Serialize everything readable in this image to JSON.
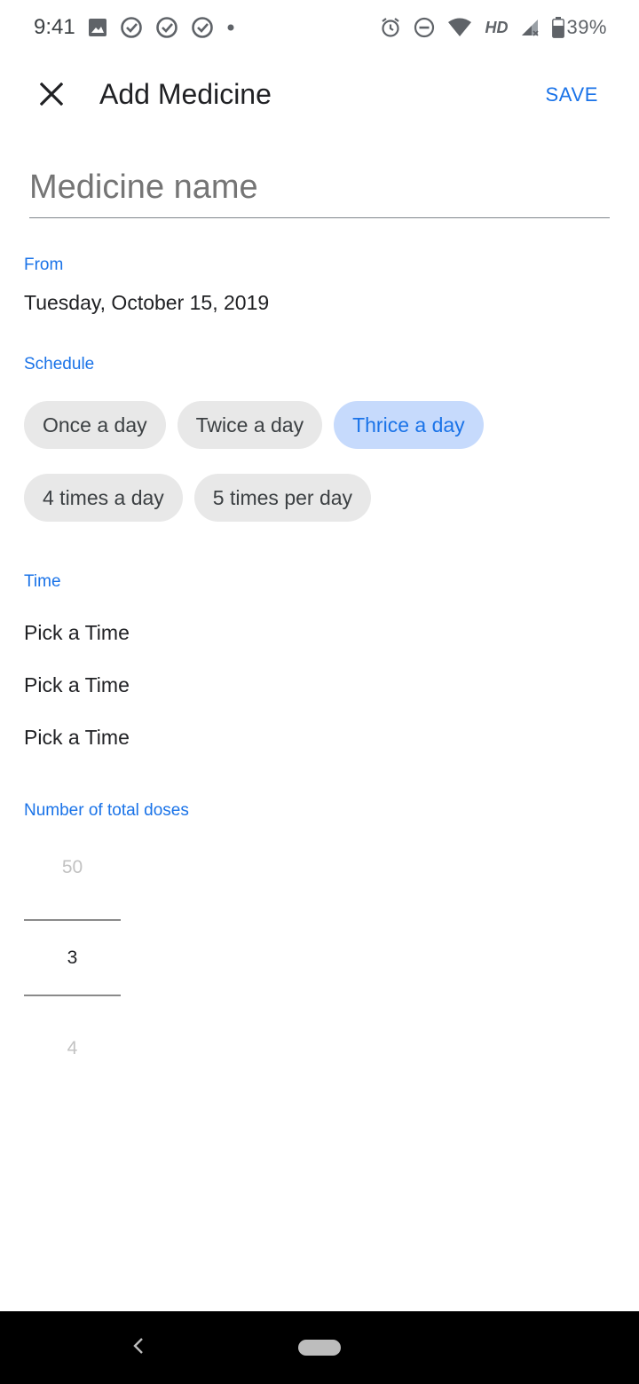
{
  "status_bar": {
    "time": "9:41",
    "battery": "39%",
    "network_badge": "HD",
    "icons": [
      "image-icon",
      "check-circle-icon",
      "check-circle-icon",
      "check-circle-icon",
      "dot-icon",
      "alarm-icon",
      "do-not-disturb-icon",
      "wifi-icon",
      "signal-icon",
      "battery-icon"
    ]
  },
  "app_bar": {
    "title": "Add Medicine",
    "save_label": "SAVE",
    "close_icon": "close-icon"
  },
  "form": {
    "name_placeholder": "Medicine name",
    "name_value": "",
    "from_label": "From",
    "from_value": "Tuesday, October 15, 2019",
    "schedule_label": "Schedule",
    "schedule_options": [
      {
        "label": "Once a day",
        "selected": false
      },
      {
        "label": "Twice a day",
        "selected": false
      },
      {
        "label": "Thrice a day",
        "selected": true
      },
      {
        "label": "4 times a day",
        "selected": false
      },
      {
        "label": "5 times per day",
        "selected": false
      }
    ],
    "time_label": "Time",
    "times": [
      "Pick a Time",
      "Pick a Time",
      "Pick a Time"
    ],
    "doses_label": "Number of total doses",
    "doses_picker": {
      "previous": "50",
      "current": "3",
      "next": "4"
    }
  },
  "colors": {
    "accent": "#1a73e8",
    "chip_bg": "#e8e8e8",
    "chip_selected_bg": "#c6dafc",
    "nav_bar": "#000000"
  },
  "nav_bar": {
    "back_icon": "back-chevron-icon",
    "home_icon": "home-pill-icon"
  }
}
